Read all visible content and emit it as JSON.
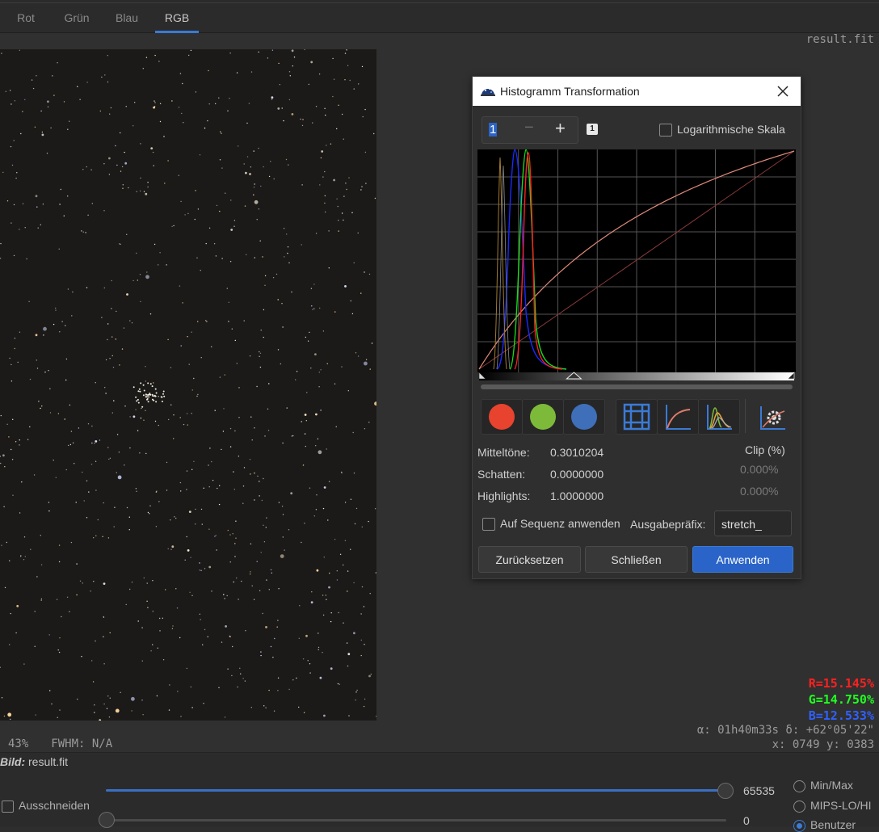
{
  "tabs": [
    "Rot",
    "Grün",
    "Blau",
    "RGB"
  ],
  "active_tab": "RGB",
  "viewer": {
    "filename": "result.fit",
    "readout": {
      "r": "R=15.145%",
      "g": "G=14.750%",
      "b": "B=12.533%"
    },
    "coords": {
      "ra_dec": "α: 01h40m33s δ: +62°05'22\"",
      "xy": "x: 0749 y: 0383"
    },
    "zoom": "43%",
    "fwhm": "FWHM: N/A"
  },
  "bottom": {
    "bild_label": "Bild:",
    "bild_value": "result.fit",
    "crop_label": "Ausschneiden",
    "max_value": "65535",
    "min_value": "0",
    "radios": [
      "Min/Max",
      "MIPS-LO/HI",
      "Benutzer"
    ],
    "selected_radio": "Benutzer",
    "max_slider_fraction": 1.0,
    "min_slider_fraction": 0.0
  },
  "dialog": {
    "title": "Histogramm Transformation",
    "spin_value": "1",
    "spin_minus": "−",
    "spin_plus": "+",
    "badge": "1",
    "log_scale_label": "Logarithmische Skala",
    "log_scale_checked": false,
    "channel_colors": {
      "red": "#e8432e",
      "green": "#7dba3a",
      "blue": "#3f6fb8"
    },
    "tool_icons": [
      "grid-icon",
      "curve-icon",
      "histogram-icon",
      "settings-icon"
    ],
    "midtones_label": "Mitteltöne:",
    "midtones_value": "0.3010204",
    "shadows_label": "Schatten:",
    "shadows_value": "0.0000000",
    "highlights_label": "Highlights:",
    "highlights_value": "1.0000000",
    "clip_header": "Clip (%)",
    "clip_shadows": "0.000%",
    "clip_highlights": "0.000%",
    "apply_sequence_label": "Auf Sequenz anwenden",
    "apply_sequence_checked": false,
    "prefix_label": "Ausgabepräfix:",
    "prefix_value": "stretch_",
    "buttons": {
      "reset": "Zurücksetzen",
      "close": "Schließen",
      "apply": "Anwenden"
    }
  }
}
